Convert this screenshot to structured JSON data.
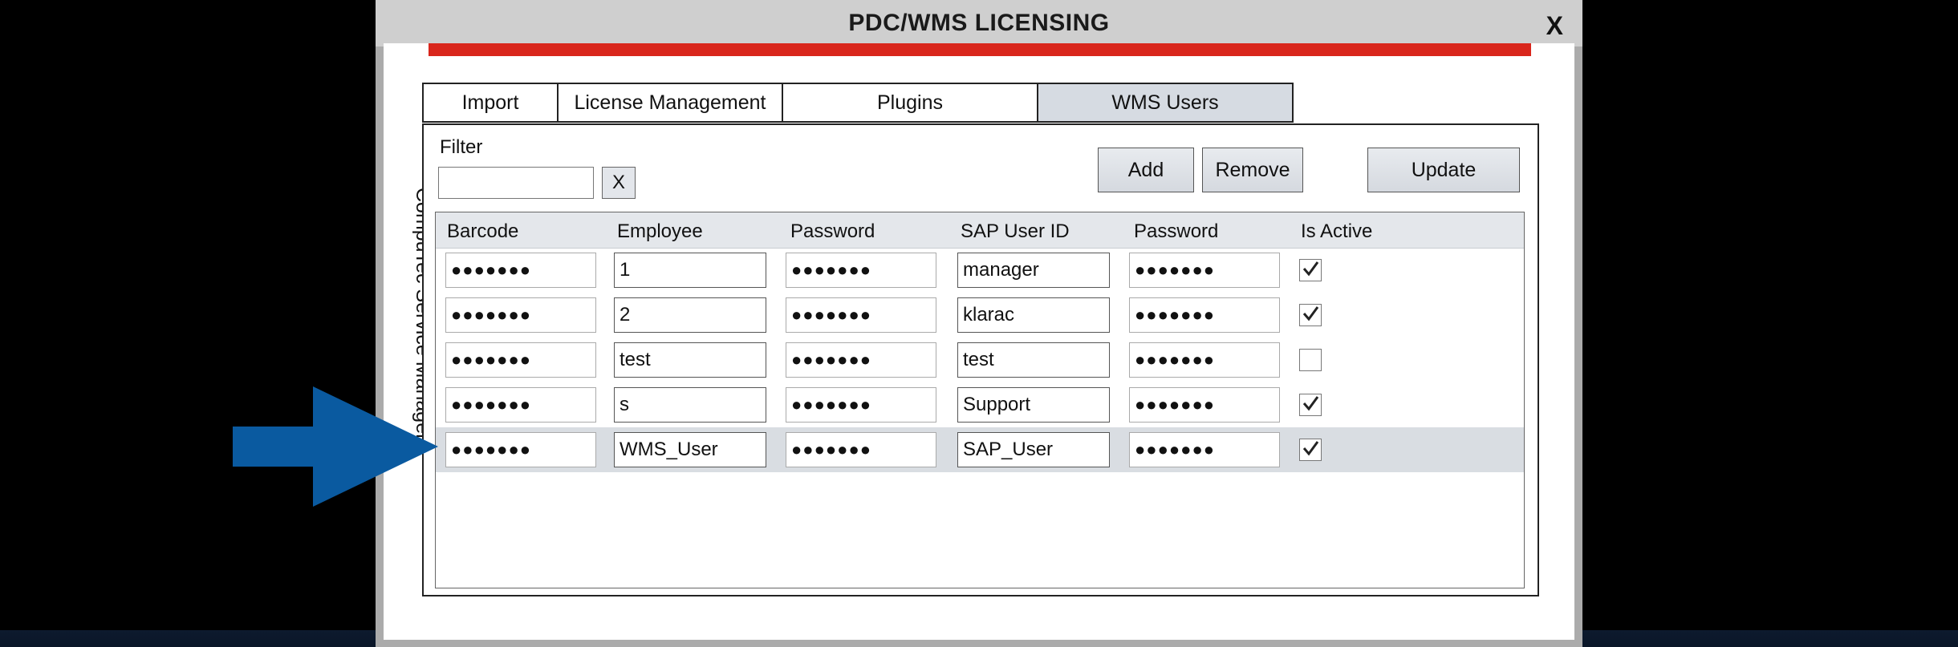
{
  "window": {
    "title": "PDC/WMS LICENSING",
    "close_label": "X"
  },
  "side_label": "CompuTec Service Manager",
  "tabs": [
    {
      "label": "Import",
      "active": false
    },
    {
      "label": "License Management",
      "active": false
    },
    {
      "label": "Plugins",
      "active": false
    },
    {
      "label": "WMS Users",
      "active": true
    }
  ],
  "filter": {
    "label": "Filter",
    "value": "",
    "clear_label": "X"
  },
  "actions": {
    "add_label": "Add",
    "remove_label": "Remove",
    "update_label": "Update"
  },
  "table": {
    "columns": [
      "Barcode",
      "Employee",
      "Password",
      "SAP User ID",
      "Password",
      "Is Active"
    ],
    "rows": [
      {
        "barcode": "●●●●●●●",
        "employee": "1",
        "password": "●●●●●●●",
        "sap_user_id": "manager",
        "sap_password": "●●●●●●●",
        "is_active": true
      },
      {
        "barcode": "●●●●●●●",
        "employee": "2",
        "password": "●●●●●●●",
        "sap_user_id": "klarac",
        "sap_password": "●●●●●●●",
        "is_active": true
      },
      {
        "barcode": "●●●●●●●",
        "employee": "test",
        "password": "●●●●●●●",
        "sap_user_id": "test",
        "sap_password": "●●●●●●●",
        "is_active": false
      },
      {
        "barcode": "●●●●●●●",
        "employee": "s",
        "password": "●●●●●●●",
        "sap_user_id": "Support",
        "sap_password": "●●●●●●●",
        "is_active": true
      },
      {
        "barcode": "●●●●●●●",
        "employee": "WMS_User",
        "password": "●●●●●●●",
        "sap_user_id": "SAP_User",
        "sap_password": "●●●●●●●",
        "is_active": true
      }
    ],
    "selected_row": 4
  },
  "colors": {
    "accent_bar": "#d9261c",
    "arrow": "#0a5aa0",
    "active_tab": "#d6dbe2"
  },
  "icons": {
    "arrow": "arrow-right-icon",
    "check": "checkmark-icon"
  }
}
